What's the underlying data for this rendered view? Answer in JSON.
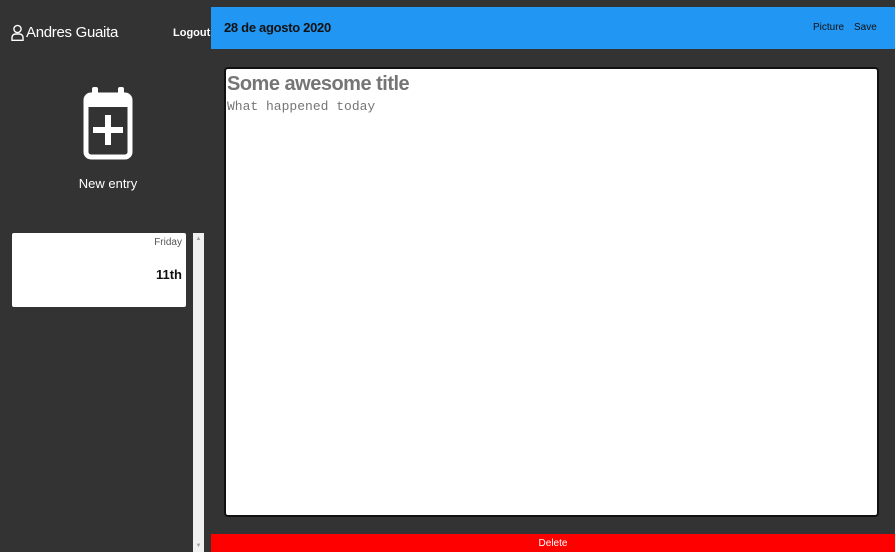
{
  "user": {
    "name": "Andres Guaita",
    "icon": "user-icon"
  },
  "sidebar": {
    "logout_label": "Logout",
    "new_entry_label": "New entry",
    "new_entry_icon": "calendar-plus-icon",
    "entries": [
      {
        "day": "Friday",
        "date": "11th"
      }
    ]
  },
  "header": {
    "date": "28 de agosto 2020",
    "picture_label": "Picture",
    "save_label": "Save"
  },
  "editor": {
    "title_placeholder": "Some awesome title",
    "body_placeholder": "What happened today"
  },
  "footer": {
    "delete_label": "Delete"
  },
  "colors": {
    "header": "#2196f3",
    "delete": "#ff0000",
    "sidebar": "#333333"
  }
}
